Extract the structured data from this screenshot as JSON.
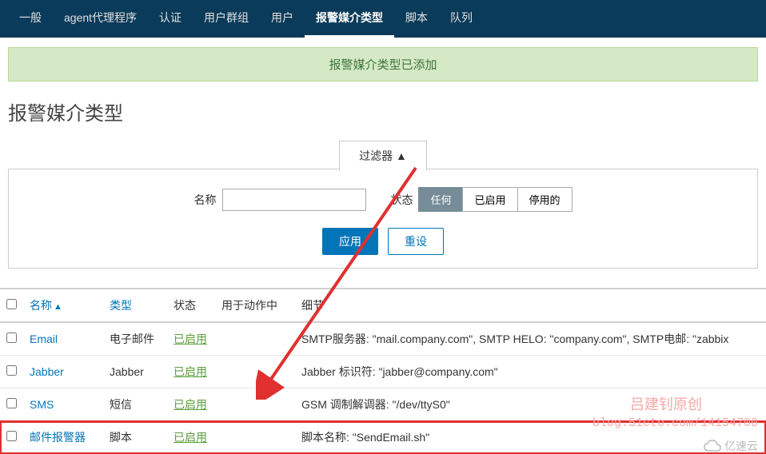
{
  "tabs": {
    "items": [
      {
        "label": "一般"
      },
      {
        "label": "agent代理程序"
      },
      {
        "label": "认证"
      },
      {
        "label": "用户群组"
      },
      {
        "label": "用户"
      },
      {
        "label": "报警媒介类型"
      },
      {
        "label": "脚本"
      },
      {
        "label": "队列"
      }
    ],
    "active_index": 5
  },
  "message": "报警媒介类型已添加",
  "page_title": "报警媒介类型",
  "filter": {
    "tab_label": "过滤器 ▲",
    "name_label": "名称",
    "name_value": "",
    "status_label": "状态",
    "status_options": [
      "任何",
      "已启用",
      "停用的"
    ],
    "status_selected": 0,
    "apply_label": "应用",
    "reset_label": "重设"
  },
  "table": {
    "headers": {
      "name": "名称",
      "type": "类型",
      "status": "状态",
      "used_in": "用于动作中",
      "details": "细节"
    },
    "rows": [
      {
        "name": "Email",
        "type": "电子邮件",
        "status": "已启用",
        "details": "SMTP服务器: \"mail.company.com\", SMTP HELO: \"company.com\", SMTP电邮: \"zabbix"
      },
      {
        "name": "Jabber",
        "type": "Jabber",
        "status": "已启用",
        "details": "Jabber 标识符: \"jabber@company.com\""
      },
      {
        "name": "SMS",
        "type": "短信",
        "status": "已启用",
        "details": "GSM 调制解调器: \"/dev/ttyS0\""
      },
      {
        "name": "邮件报警器",
        "type": "脚本",
        "status": "已启用",
        "details": "脚本名称: \"SendEmail.sh\""
      }
    ],
    "highlight_index": 3
  },
  "watermark": {
    "text1": "吕建钊原创",
    "text2": "blog.51cto.com/14154700",
    "cloud": "亿速云"
  }
}
